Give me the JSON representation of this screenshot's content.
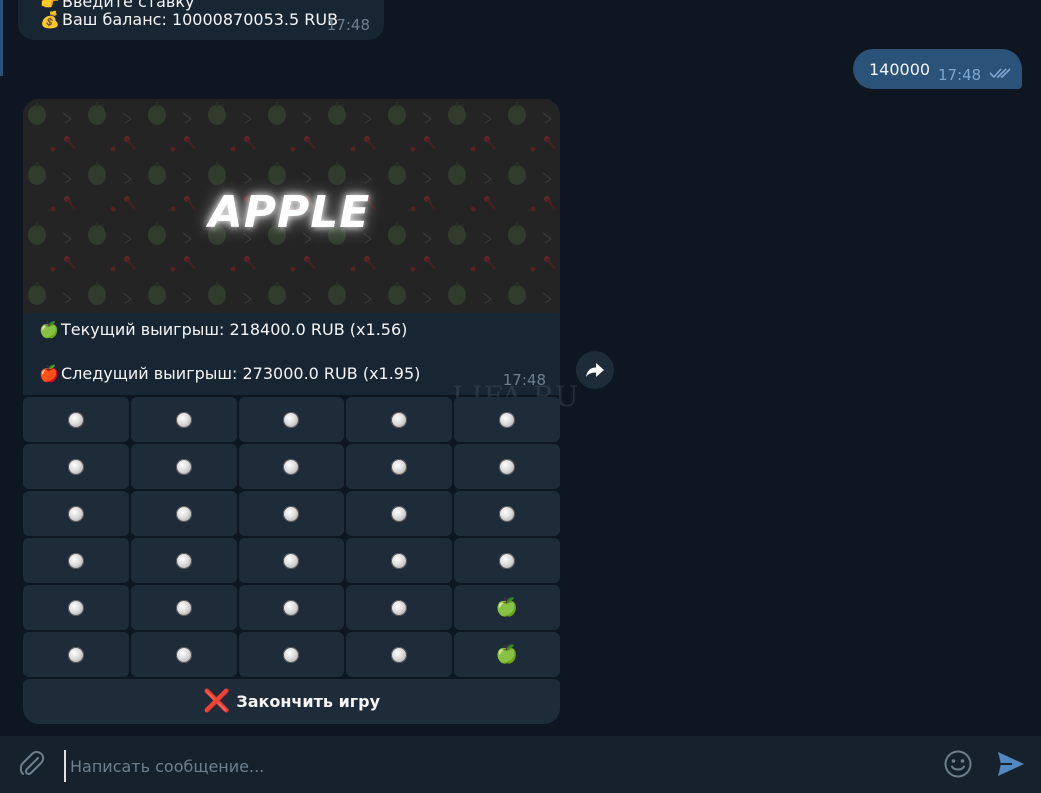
{
  "top_message": {
    "line1_emoji": "👉",
    "line1_text": "Введите ставку",
    "line2_emoji": "💰",
    "line2_text": "Ваш баланс: 10000870053.5 RUB",
    "time": "17:48"
  },
  "outgoing_message": {
    "text": "140000",
    "time": "17:48",
    "status": "read"
  },
  "game": {
    "banner_title": "APPLE",
    "current_emoji": "🍏",
    "current_text": "Текущий выигрыш: 218400.0 RUB (x1.56)",
    "next_emoji": "🍎",
    "next_text": "Следущий выигрыш: 273000.0 RUB (x1.95)",
    "time": "17:48",
    "grid": [
      [
        "dot",
        "dot",
        "dot",
        "dot",
        "dot"
      ],
      [
        "dot",
        "dot",
        "dot",
        "dot",
        "dot"
      ],
      [
        "dot",
        "dot",
        "dot",
        "dot",
        "dot"
      ],
      [
        "dot",
        "dot",
        "dot",
        "dot",
        "dot"
      ],
      [
        "dot",
        "dot",
        "dot",
        "dot",
        "apple"
      ],
      [
        "dot",
        "dot",
        "dot",
        "dot",
        "apple"
      ]
    ],
    "apple_glyph": "🍏",
    "end_button_icon": "❌",
    "end_button_label": "Закончить игру"
  },
  "watermark": "LIFA.RU",
  "composer": {
    "placeholder": "Написать сообщение..."
  },
  "colors": {
    "background": "#0e1621",
    "bubble_in": "#182533",
    "bubble_out": "#2b5278",
    "button": "#1e2c3a"
  }
}
